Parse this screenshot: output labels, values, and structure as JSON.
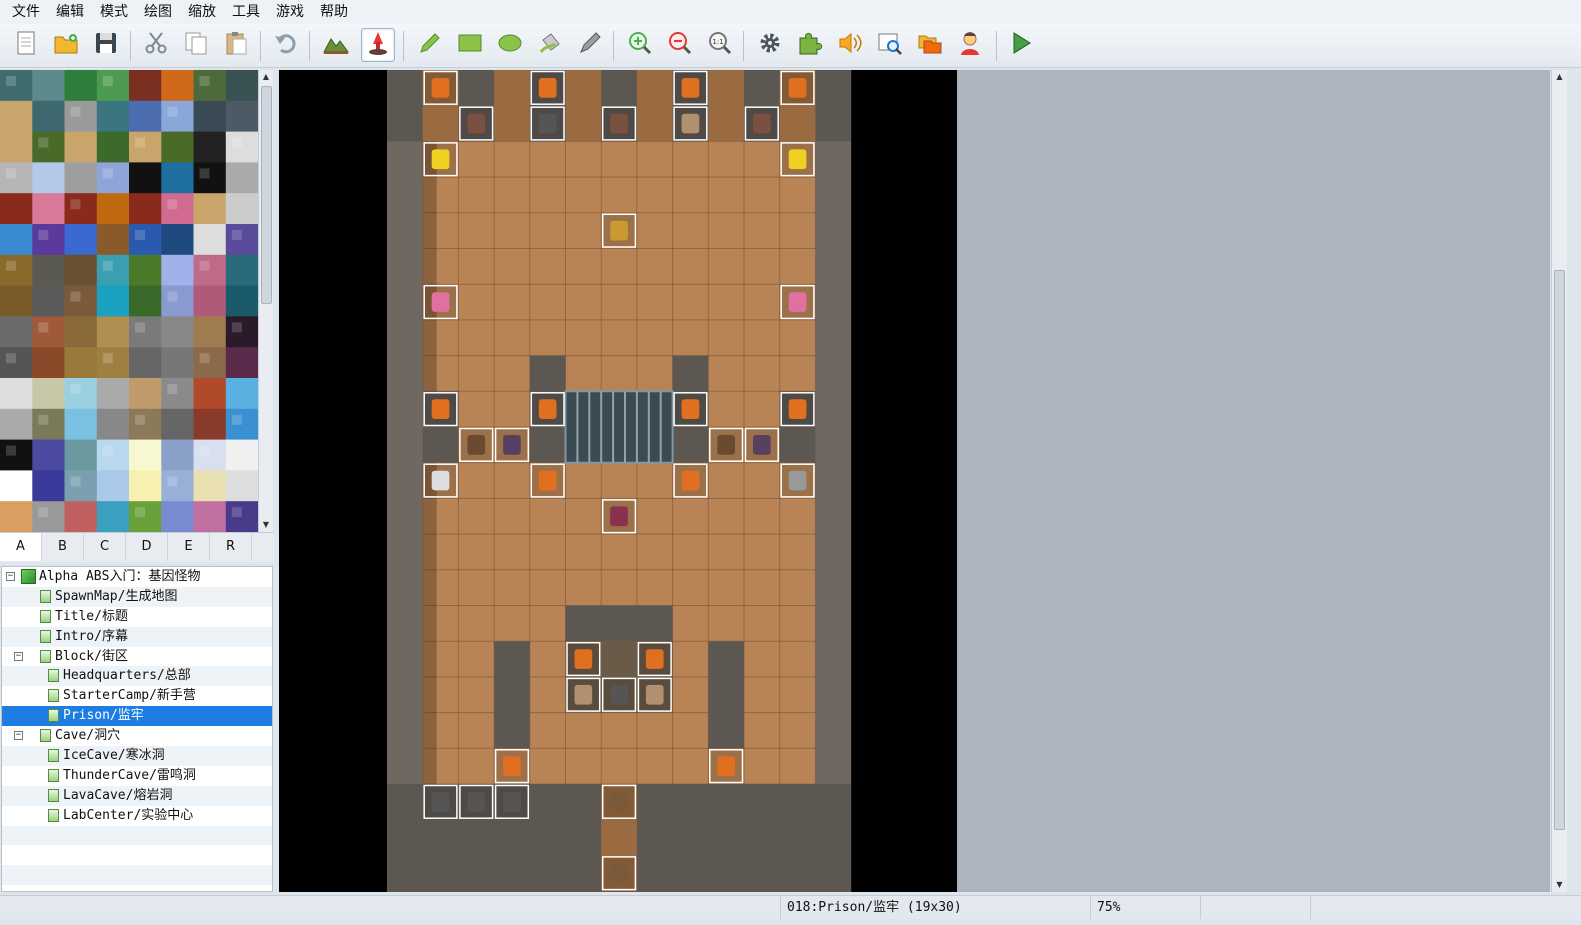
{
  "menu": [
    "文件",
    "编辑",
    "模式",
    "绘图",
    "缩放",
    "工具",
    "游戏",
    "帮助"
  ],
  "toolbar": [
    {
      "name": "new-project",
      "icon": "new-document-icon"
    },
    {
      "name": "open-project",
      "icon": "open-folder-icon"
    },
    {
      "name": "save-project",
      "icon": "save-disk-icon"
    },
    {
      "name": "cut",
      "icon": "scissors-icon"
    },
    {
      "name": "copy",
      "icon": "copy-icon"
    },
    {
      "name": "paste",
      "icon": "paste-icon"
    },
    {
      "name": "undo",
      "icon": "undo-arrow-icon"
    },
    {
      "name": "map-mode",
      "icon": "map-layer-icon"
    },
    {
      "name": "event-mode",
      "icon": "event-pin-icon",
      "active": true
    },
    {
      "name": "pencil",
      "icon": "pencil-icon"
    },
    {
      "name": "rectangle",
      "icon": "rectangle-icon"
    },
    {
      "name": "ellipse",
      "icon": "ellipse-icon"
    },
    {
      "name": "flood-fill",
      "icon": "bucket-icon"
    },
    {
      "name": "shadow-pen",
      "icon": "shadow-pen-icon"
    },
    {
      "name": "zoom-in",
      "icon": "zoom-in-icon"
    },
    {
      "name": "zoom-out",
      "icon": "zoom-out-icon"
    },
    {
      "name": "actual-size",
      "icon": "zoom-actual-icon"
    },
    {
      "name": "database",
      "icon": "gear-icon"
    },
    {
      "name": "plugin-manager",
      "icon": "puzzle-icon"
    },
    {
      "name": "sound-test",
      "icon": "speaker-icon"
    },
    {
      "name": "event-searcher",
      "icon": "search-window-icon"
    },
    {
      "name": "resource-manager",
      "icon": "folders-icon"
    },
    {
      "name": "character-generator",
      "icon": "character-icon"
    },
    {
      "name": "playtest",
      "icon": "play-icon"
    }
  ],
  "tileset_tabs": [
    "A",
    "B",
    "C",
    "D",
    "E",
    "R"
  ],
  "active_tab": "A",
  "tree": [
    {
      "label": "Alpha ABS入门：基因怪物",
      "level": 0,
      "expander": "−",
      "kind": "project"
    },
    {
      "label": "SpawnMap/生成地图",
      "level": 1,
      "kind": "map"
    },
    {
      "label": "Title/标题",
      "level": 1,
      "kind": "map"
    },
    {
      "label": "Intro/序幕",
      "level": 1,
      "kind": "map"
    },
    {
      "label": "Block/街区",
      "level": 1,
      "expander": "−",
      "kind": "map"
    },
    {
      "label": "Headquarters/总部",
      "level": 2,
      "kind": "map"
    },
    {
      "label": "StarterCamp/新手营",
      "level": 2,
      "kind": "map"
    },
    {
      "label": "Prison/监牢",
      "level": 2,
      "kind": "map",
      "selected": true
    },
    {
      "label": "Cave/洞穴",
      "level": 1,
      "expander": "−",
      "kind": "map"
    },
    {
      "label": "IceCave/寒冰洞",
      "level": 2,
      "kind": "map"
    },
    {
      "label": "ThunderCave/雷鸣洞",
      "level": 2,
      "kind": "map"
    },
    {
      "label": "LavaCave/熔岩洞",
      "level": 2,
      "kind": "map"
    },
    {
      "label": "LabCenter/实验中心",
      "level": 2,
      "kind": "map"
    },
    {
      "label": "",
      "level": 0,
      "kind": "empty"
    },
    {
      "label": "",
      "level": 0,
      "kind": "empty"
    },
    {
      "label": "",
      "level": 0,
      "kind": "empty"
    }
  ],
  "status": {
    "map_info": "018:Prison/监牢 (19x30)",
    "zoom": "75%"
  }
}
